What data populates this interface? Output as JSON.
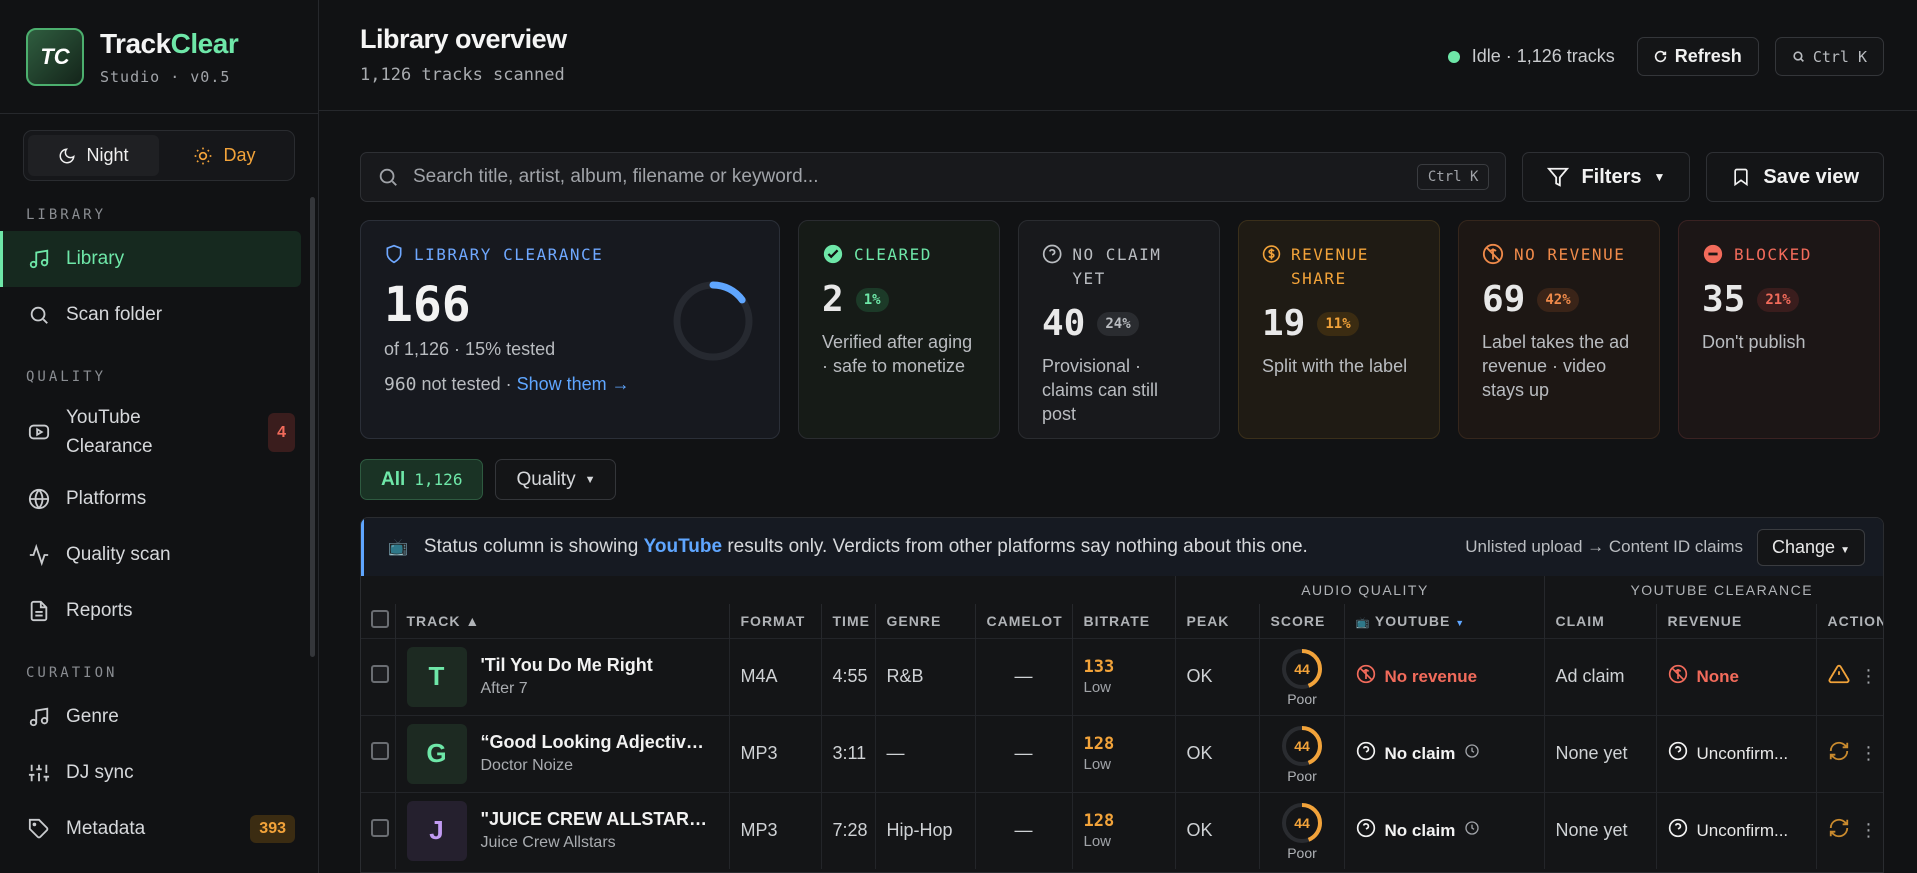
{
  "brand": {
    "name_a": "Track",
    "name_b": "Clear",
    "subtitle": "Studio · v0.5",
    "logo_text": "TC"
  },
  "theme": {
    "night": "Night",
    "day": "Day"
  },
  "sidebar": {
    "sections": {
      "library": "LIBRARY",
      "quality": "QUALITY",
      "curation": "CURATION"
    },
    "items": [
      {
        "label": "Library",
        "icon": "music-note-icon"
      },
      {
        "label": "Scan folder",
        "icon": "search-icon"
      },
      {
        "label": "YouTube Clearance",
        "icon": "youtube-icon",
        "badge": "4"
      },
      {
        "label": "Platforms",
        "icon": "globe-icon"
      },
      {
        "label": "Quality scan",
        "icon": "activity-icon"
      },
      {
        "label": "Reports",
        "icon": "document-icon"
      },
      {
        "label": "Genre",
        "icon": "music-note-icon"
      },
      {
        "label": "DJ sync",
        "icon": "sliders-icon"
      },
      {
        "label": "Metadata",
        "icon": "tag-icon",
        "badge": "393"
      }
    ]
  },
  "header": {
    "title": "Library overview",
    "subtitle": "1,126 tracks scanned",
    "status": "Idle · 1,126 tracks",
    "refresh": "Refresh",
    "shortcut": "Ctrl K"
  },
  "search": {
    "placeholder": "Search title, artist, album, filename or keyword...",
    "shortcut": "Ctrl K",
    "filters": "Filters",
    "save": "Save view"
  },
  "cards": {
    "library": {
      "title": "LIBRARY CLEARANCE",
      "value": "166",
      "of": "of 1,126 · 15% tested",
      "not_tested_count": "960",
      "not_tested_text": "not tested ·",
      "link": "Show them →",
      "progress": 0.15
    },
    "cleared": {
      "title": "CLEARED",
      "value": "2",
      "pct": "1%",
      "desc": "Verified after aging · safe to monetize"
    },
    "noclaim": {
      "title": "NO CLAIM YET",
      "value": "40",
      "pct": "24%",
      "desc": "Provisional · claims can still post"
    },
    "revshare": {
      "title": "REVENUE SHARE",
      "value": "19",
      "pct": "11%",
      "desc": "Split with the label"
    },
    "norev": {
      "title": "NO REVENUE",
      "value": "69",
      "pct": "42%",
      "desc": "Label takes the ad revenue · video stays up"
    },
    "blocked": {
      "title": "BLOCKED",
      "value": "35",
      "pct": "21%",
      "desc": "Don't publish"
    }
  },
  "chips": {
    "all": "All",
    "all_count": "1,126",
    "quality": "Quality"
  },
  "banner": {
    "pre": "Status column is showing",
    "platform": "YouTube",
    "post": "results only. Verdicts from other platforms say nothing about this one.",
    "mode": "Unlisted upload → Content ID claims",
    "change": "Change"
  },
  "table": {
    "groups": {
      "audio": "AUDIO QUALITY",
      "yt": "YOUTUBE CLEARANCE"
    },
    "cols": {
      "track": "TRACK ▲",
      "format": "FORMAT",
      "time": "TIME",
      "genre": "GENRE",
      "camelot": "CAMELOT",
      "bitrate": "BITRATE",
      "peak": "PEAK",
      "score": "SCORE",
      "youtube": "YOUTUBE",
      "claim": "CLAIM",
      "revenue": "REVENUE",
      "actions": "ACTIONS"
    },
    "rows": [
      {
        "initial": "T",
        "title": "'Til You Do Me Right",
        "artist": "After 7",
        "format": "M4A",
        "time": "4:55",
        "genre": "R&B",
        "camelot": "—",
        "bitrate": "133",
        "bq": "Low",
        "peak": "OK",
        "score": "44",
        "score_label": "Poor",
        "yt": "No revenue",
        "claim": "Ad claim",
        "revenue": "None"
      },
      {
        "initial": "G",
        "title": "“Good Looking Adjectives...",
        "artist": "Doctor Noize",
        "format": "MP3",
        "time": "3:11",
        "genre": "—",
        "camelot": "—",
        "bitrate": "128",
        "bq": "Low",
        "peak": "OK",
        "score": "44",
        "score_label": "Poor",
        "yt": "No claim",
        "claim": "None yet",
        "revenue": "Unconfirm..."
      },
      {
        "initial": "J",
        "title": "\"JUICE CREW ALLSTARS\" ...",
        "artist": "Juice Crew Allstars",
        "format": "MP3",
        "time": "7:28",
        "genre": "Hip-Hop",
        "camelot": "—",
        "bitrate": "128",
        "bq": "Low",
        "peak": "OK",
        "score": "44",
        "score_label": "Poor",
        "yt": "No claim",
        "claim": "None yet",
        "revenue": "Unconfirm..."
      }
    ]
  }
}
